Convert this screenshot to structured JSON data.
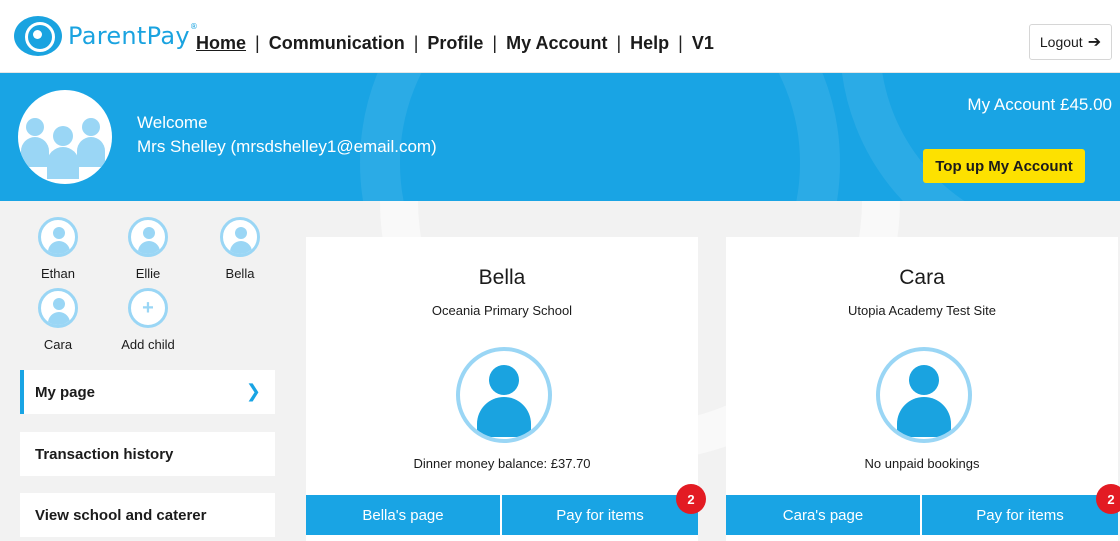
{
  "brand": {
    "name": "ParentPay",
    "reg": "®"
  },
  "nav": {
    "items": [
      "Home",
      "Communication",
      "Profile",
      "My Account",
      "Help",
      "V1"
    ],
    "separator": "|",
    "active": "Home"
  },
  "logout": {
    "label": "Logout",
    "icon": "logout-icon"
  },
  "banner": {
    "welcome": "Welcome",
    "user": "Mrs Shelley (mrsdshelley1@email.com)",
    "account_balance": "My Account £45.00",
    "topup_label": "Top up My Account"
  },
  "children": [
    {
      "name": "Ethan"
    },
    {
      "name": "Ellie"
    },
    {
      "name": "Bella"
    },
    {
      "name": "Cara"
    },
    {
      "name": "Add child"
    }
  ],
  "menu": {
    "items": [
      "My page",
      "Transaction history",
      "View school and caterer"
    ],
    "active": "My page"
  },
  "cards": [
    {
      "name": "Bella",
      "school": "Oceania Primary School",
      "status": "Dinner money balance: £37.70",
      "page_button": "Bella's page",
      "pay_button": "Pay for items",
      "badge": "2"
    },
    {
      "name": "Cara",
      "school": "Utopia Academy Test Site",
      "status": "No unpaid bookings",
      "page_button": "Cara's page",
      "pay_button": "Pay for items",
      "badge": "2"
    }
  ],
  "colors": {
    "brand_blue": "#19a4e4",
    "topup_yellow": "#fde100",
    "badge_red": "#e31b23",
    "light_blue": "#9ad6f5"
  }
}
